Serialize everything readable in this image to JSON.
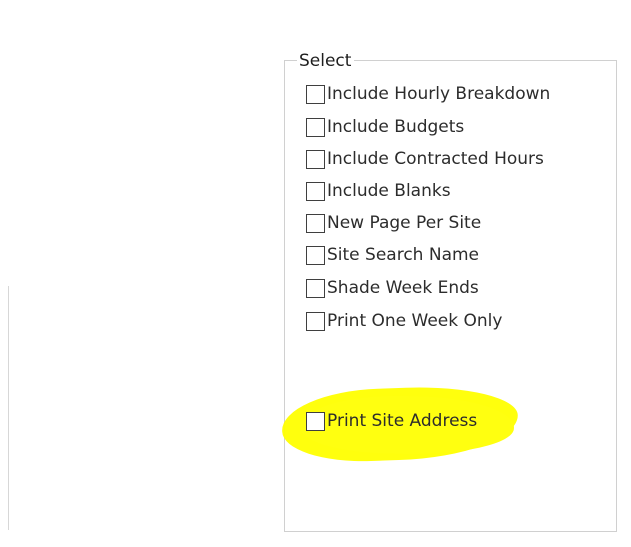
{
  "group": {
    "title": "Select"
  },
  "options": [
    {
      "label": "Include Hourly Breakdown",
      "checked": false
    },
    {
      "label": "Include Budgets",
      "checked": false
    },
    {
      "label": "Include Contracted Hours",
      "checked": false
    },
    {
      "label": "Include Blanks",
      "checked": false
    },
    {
      "label": "New Page Per Site",
      "checked": false
    },
    {
      "label": "Site Search Name",
      "checked": false
    },
    {
      "label": "Shade Week Ends",
      "checked": false
    },
    {
      "label": "Print One Week Only",
      "checked": false
    },
    {
      "label": "Print Site Address",
      "checked": false,
      "highlighted": true
    }
  ],
  "colors": {
    "highlight": "#ffff00",
    "border": "#d0d0d0",
    "checkbox_border": "#3f3f3f",
    "text": "#2c2c2c"
  }
}
